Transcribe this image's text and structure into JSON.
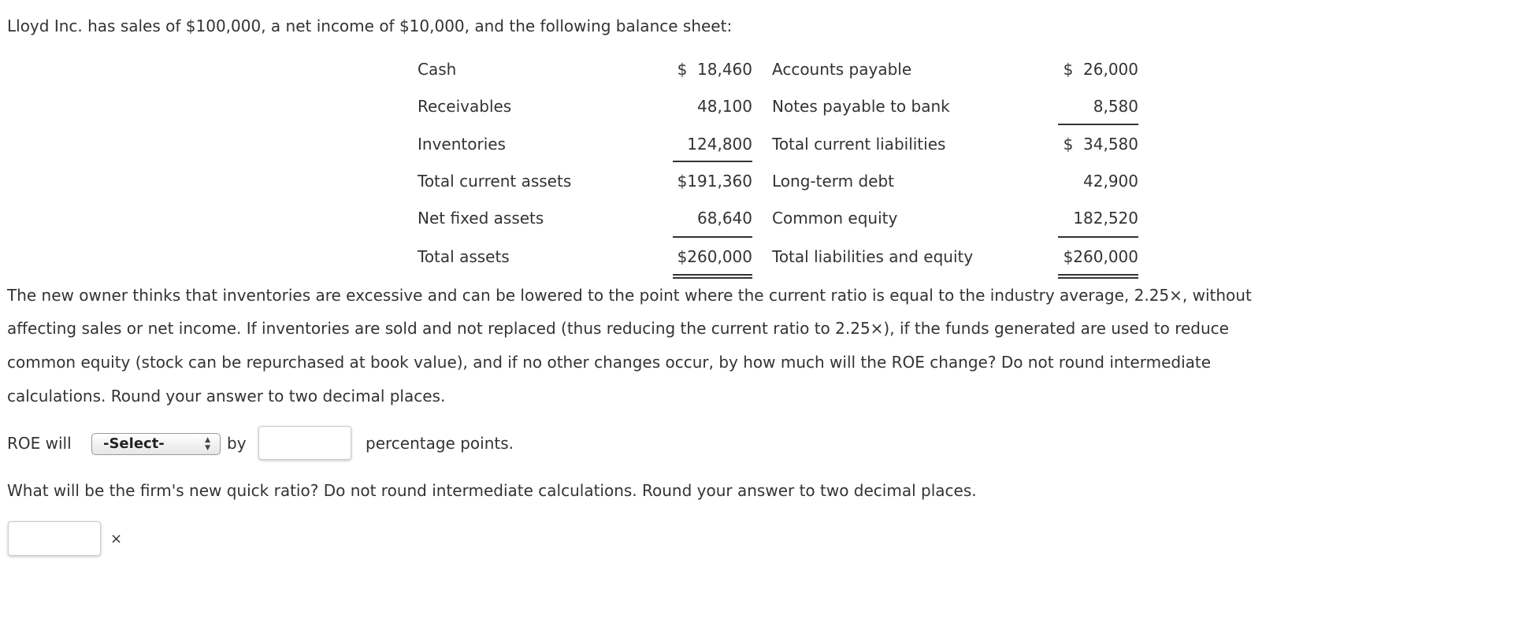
{
  "intro": "Lloyd Inc. has sales of $100,000, a net income of $10,000, and the following balance sheet:",
  "balance_sheet": [
    {
      "asset": "Cash",
      "asset_value": "$  18,460",
      "liability": "Accounts payable",
      "liability_value": "$  26,000"
    },
    {
      "asset": "Receivables",
      "asset_value": "48,100",
      "liability": "Notes payable to bank",
      "liability_value": "8,580"
    },
    {
      "asset": "Inventories",
      "asset_value": "124,800",
      "liability": "Total current liabilities",
      "liability_value": "$  34,580"
    },
    {
      "asset": "Total current assets",
      "asset_value": "$191,360",
      "liability": "Long-term debt",
      "liability_value": "42,900"
    },
    {
      "asset": "Net fixed assets",
      "asset_value": "68,640",
      "liability": "Common equity",
      "liability_value": "182,520"
    },
    {
      "asset": "Total assets",
      "asset_value": "$260,000",
      "liability": "Total liabilities and equity",
      "liability_value": "$260,000"
    }
  ],
  "problem_lines": [
    "The new owner thinks that inventories are excessive and can be lowered to the point where the current ratio is equal to the industry average, 2.25×, without",
    "affecting sales or net income. If inventories are sold and not replaced (thus reducing the current ratio to 2.25×), if the funds generated are used to reduce",
    "common equity (stock can be repurchased at book value), and if no other changes occur, by how much will the ROE change? Do not round intermediate",
    "calculations. Round your answer to two decimal places."
  ],
  "roe": {
    "prefix": "ROE will",
    "select_value": "-Select-",
    "by": "by",
    "input_value": "",
    "suffix": "percentage points."
  },
  "q2": {
    "text": "What will be the firm's new quick ratio? Do not round intermediate calculations. Round your answer to two decimal places.",
    "input_value": "",
    "suffix": "×"
  }
}
